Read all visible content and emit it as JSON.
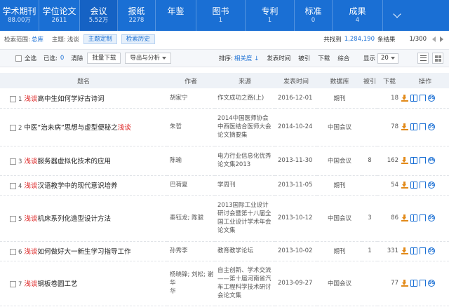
{
  "tabs": [
    {
      "name": "学术期刊",
      "count": "88.00万",
      "width": 56
    },
    {
      "name": "学位论文",
      "count": "2611",
      "width": 58
    },
    {
      "name": "会议",
      "count": "5.52万",
      "width": 54,
      "active": true
    },
    {
      "name": "报纸",
      "count": "2278",
      "width": 54
    },
    {
      "name": "年鉴",
      "count": "",
      "width": 58
    },
    {
      "name": "图书",
      "count": "1",
      "width": 70
    },
    {
      "name": "专利",
      "count": "1",
      "width": 70
    },
    {
      "name": "标准",
      "count": "0",
      "width": 54
    },
    {
      "name": "成果",
      "count": "4",
      "width": 72
    }
  ],
  "scope": {
    "label": "检索范围:",
    "value": "总库",
    "topic_label": "主题:",
    "topic_value": "浅谈",
    "custom_btn": "主题定制",
    "history_btn": "检索历史",
    "total_prefix": "共找到",
    "total": "1,284,190",
    "total_suffix": "条结果",
    "page": "1/300"
  },
  "toolbar": {
    "select_all": "全选",
    "selected_label": "已选:",
    "selected_count": "0",
    "clear": "清除",
    "batch_download": "批量下载",
    "export": "导出与分析",
    "sort_label": "排序:",
    "sort_relevance": "相关度",
    "sort_date": "发表时间",
    "sort_cite": "被引",
    "sort_dl": "下载",
    "sort_all": "综合",
    "show_label": "显示",
    "show_count": "20"
  },
  "columns": [
    "题名",
    "作者",
    "来源",
    "发表时间",
    "数据库",
    "被引",
    "下载",
    "操作"
  ],
  "rows": [
    {
      "n": "1",
      "hl": "浅谈",
      "rest": "高中生如何学好古诗词",
      "hl_pos": "start",
      "author": "胡家宁",
      "source": "作文成功之路(上)",
      "date": "2016-12-01",
      "db": "期刊",
      "cite": "",
      "dl": "18",
      "h": 28
    },
    {
      "n": "2",
      "hl": "浅谈",
      "rest": "中医“治未病”思想与虚型便秘之",
      "hl_pos": "end",
      "author": "朱哲",
      "source": "2014中国医师协会\n中西医结合医师大会\n论文摘要集",
      "date": "2014-10-24",
      "db": "中国会议",
      "cite": "",
      "dl": "78",
      "h": 54
    },
    {
      "n": "3",
      "hl": "浅谈",
      "rest": "服务器虚拟化技术的应用",
      "hl_pos": "start",
      "author": "陈瑜",
      "source": "电力行业信息化优秀\n论文集2013",
      "date": "2013-11-30",
      "db": "中国会议",
      "cite": "8",
      "dl": "162",
      "h": 42
    },
    {
      "n": "4",
      "hl": "浅谈",
      "rest": "汉语教学中的现代意识培养",
      "hl_pos": "start",
      "author": "巴荷夏",
      "source": "学周刊",
      "date": "2013-11-05",
      "db": "期刊",
      "cite": "",
      "dl": "54",
      "h": 28
    },
    {
      "n": "5",
      "hl": "浅谈",
      "rest": "机床系列化造型设计方法",
      "hl_pos": "start",
      "author": "秦钰龙; 陈骏",
      "source": "2013国际工业设计\n研讨会暨第十八届全\n国工业设计学术年会\n论文集",
      "date": "2013-10-12",
      "db": "中国会议",
      "cite": "3",
      "dl": "86",
      "h": 66
    },
    {
      "n": "6",
      "hl": "浅谈",
      "rest": "如何做好大一新生学习指导工作",
      "hl_pos": "start",
      "author": "孙秀李",
      "source": "教育教学论坛",
      "date": "2013-10-02",
      "db": "期刊",
      "cite": "1",
      "dl": "331",
      "h": 28
    },
    {
      "n": "7",
      "hl": "浅谈",
      "rest": "钢板卷圆工艺",
      "hl_pos": "start",
      "author": "杨晓锋; 刘松; 谢华\n华",
      "source": "自主创新、学术交流\n——第十届河南省汽\n车工程科学技术研讨\n会论文集",
      "date": "2013-09-27",
      "db": "中国会议",
      "cite": "",
      "dl": "77",
      "h": 64
    }
  ]
}
